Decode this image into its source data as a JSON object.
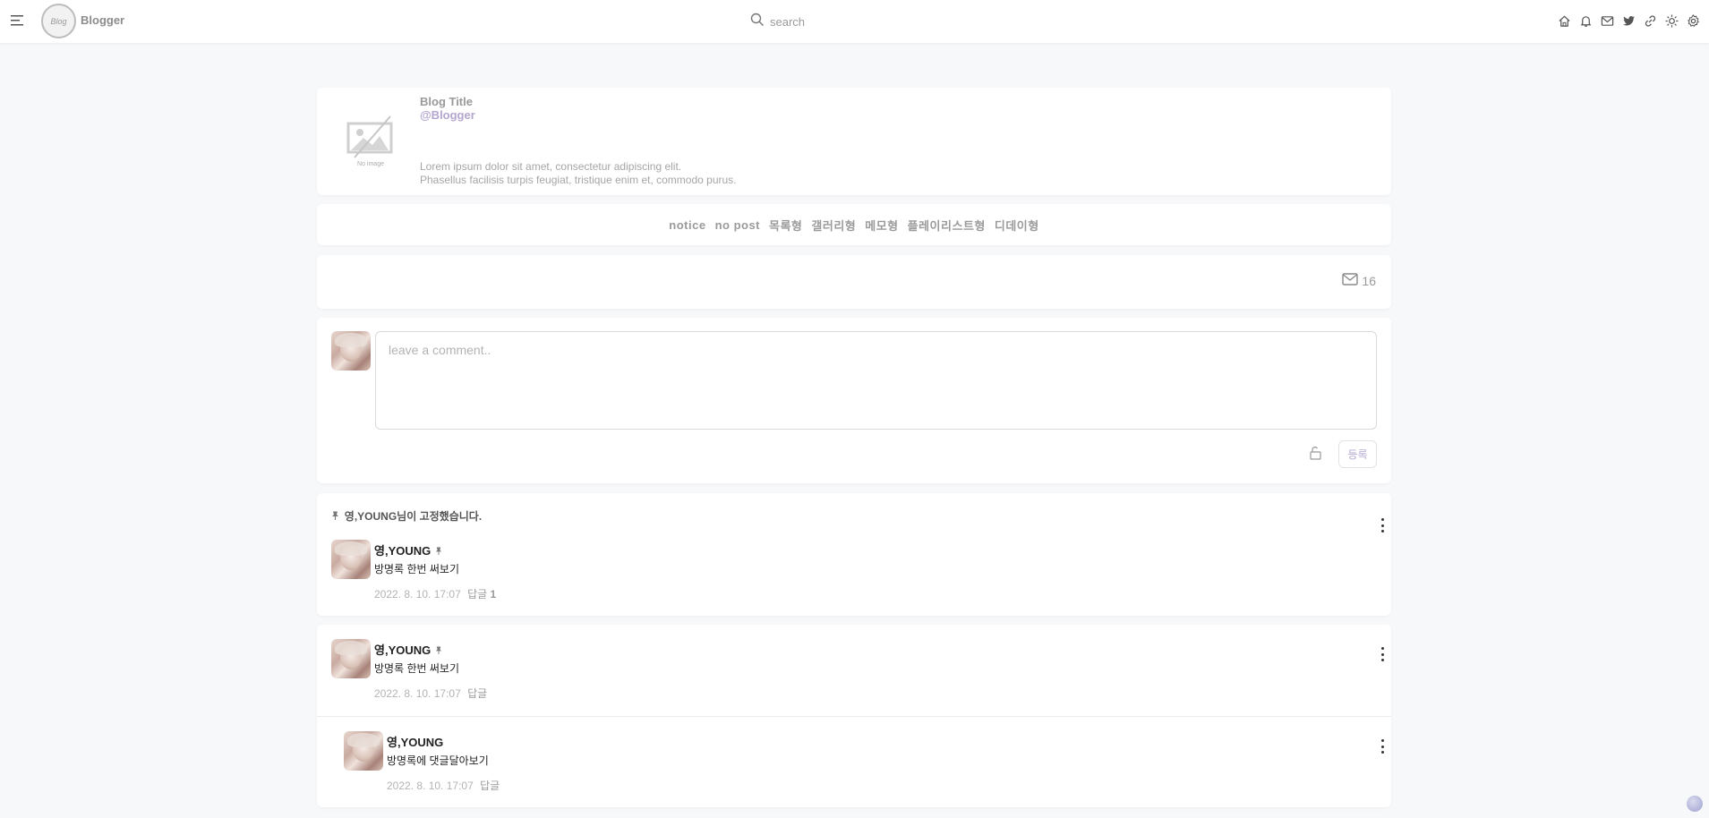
{
  "header": {
    "brand": "Blogger",
    "logo_text": "Blog",
    "search_placeholder": "search",
    "icons": [
      "home-icon",
      "bell-icon",
      "mail-icon",
      "twitter-icon",
      "link-icon",
      "sun-icon",
      "gear-icon"
    ]
  },
  "profile": {
    "title": "Blog Title",
    "handle": "@Blogger",
    "no_image_label": "No image",
    "description": [
      "Lorem ipsum dolor sit amet, consectetur adipiscing elit.",
      "Phasellus facilisis turpis feugiat, tristique enim et, commodo purus."
    ]
  },
  "nav": {
    "items": [
      "notice",
      "no post",
      "목록형",
      "갤러리형",
      "메모형",
      "플레이리스트형",
      "디데이형"
    ]
  },
  "guestbook": {
    "count": "16"
  },
  "composer": {
    "placeholder": "leave a comment..",
    "submit_label": "등록"
  },
  "pinned": {
    "notice": "영,YOUNG님이 고정했습니다.",
    "pin_glyph": "📌",
    "entry": {
      "author": "영,YOUNG",
      "text": "방명록 한번 써보기",
      "date": "2022. 8. 10. 17:07",
      "reply_label": "답글",
      "reply_count": "1"
    }
  },
  "thread": {
    "entry": {
      "author": "영,YOUNG",
      "text": "방명록 한번 써보기",
      "date": "2022. 8. 10. 17:07",
      "reply_label": "답글"
    },
    "reply": {
      "author": "영,YOUNG",
      "text": "방명록에 댓글달아보기",
      "date": "2022. 8. 10. 17:07",
      "reply_label": "답글"
    }
  },
  "colors": {
    "accent": "#b3a6cf",
    "background": "#f7f8fa"
  }
}
